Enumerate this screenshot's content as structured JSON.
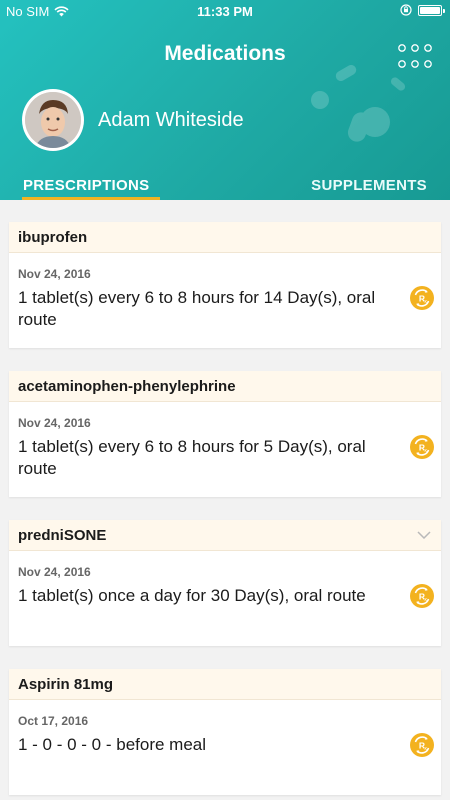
{
  "status_bar": {
    "carrier": "No SIM",
    "time": "11:33 PM",
    "battery_level": 0.9
  },
  "header": {
    "title": "Medications",
    "user_name": "Adam Whiteside",
    "tabs": [
      {
        "label": "PRESCRIPTIONS",
        "active": true
      },
      {
        "label": "SUPPLEMENTS",
        "active": false
      }
    ]
  },
  "colors": {
    "accent": "#f0b322",
    "header_teal": "#1faaa5",
    "card_header_bg": "#fff8ec"
  },
  "prescriptions": [
    {
      "name": "ibuprofen",
      "date": "Nov 24, 2016",
      "dose": "1 tablet(s) every 6 to 8 hours for 14 Day(s), oral route",
      "icon": "rx-refill-icon"
    },
    {
      "name": "acetaminophen-phenylephrine",
      "date": "Nov 24, 2016",
      "dose": "1 tablet(s) every 6 to 8 hours for 5 Day(s), oral route",
      "icon": "rx-refill-icon"
    },
    {
      "name": "predniSONE",
      "date": "Nov 24, 2016",
      "dose": "1 tablet(s) once a day for 30 Day(s), oral route",
      "icon": "rx-refill-icon",
      "expandable": true
    },
    {
      "name": "Aspirin 81mg",
      "date": "Oct 17, 2016",
      "dose": "1 - 0 - 0 - 0 - before meal",
      "icon": "rx-refill-icon"
    }
  ]
}
